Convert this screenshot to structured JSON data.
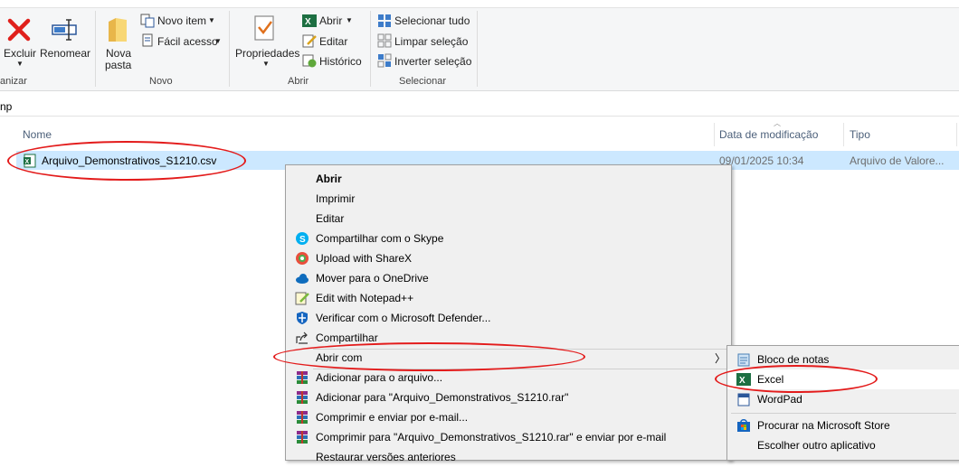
{
  "ribbon": {
    "excluir_label": "Excluir",
    "renomear_label": "Renomear",
    "nova_pasta_label_1": "Nova",
    "nova_pasta_label_2": "pasta",
    "novo_item_label": "Novo item",
    "facil_acesso_label": "Fácil acesso",
    "propriedades_label": "Propriedades",
    "abrir_label": "Abrir",
    "editar_label": "Editar",
    "historico_label": "Histórico",
    "selecionar_tudo_label": "Selecionar tudo",
    "limpar_selecao_label": "Limpar seleção",
    "inverter_selecao_label": "Inverter seleção",
    "groups": {
      "organizar": "anizar",
      "novo": "Novo",
      "abrir": "Abrir",
      "selecionar": "Selecionar"
    }
  },
  "address": {
    "text": "np"
  },
  "columns": {
    "nome": "Nome",
    "data": "Data de modificação",
    "tipo": "Tipo"
  },
  "file": {
    "name": "Arquivo_Demonstrativos_S1210.csv",
    "date": "09/01/2025 10:34",
    "type": "Arquivo de Valore..."
  },
  "context_menu": {
    "items": [
      {
        "label": "Abrir"
      },
      {
        "label": "Imprimir"
      },
      {
        "label": "Editar"
      },
      {
        "label": "Compartilhar com o Skype"
      },
      {
        "label": "Upload with ShareX"
      },
      {
        "label": "Mover para o OneDrive"
      },
      {
        "label": "Edit with Notepad++"
      },
      {
        "label": "Verificar com o Microsoft Defender..."
      },
      {
        "label": "Compartilhar"
      },
      {
        "label": "Abrir com"
      },
      {
        "label": "Adicionar para o arquivo..."
      },
      {
        "label": "Adicionar para \"Arquivo_Demonstrativos_S1210.rar\""
      },
      {
        "label": "Comprimir e enviar por e-mail..."
      },
      {
        "label": "Comprimir para \"Arquivo_Demonstrativos_S1210.rar\" e enviar por e-mail"
      },
      {
        "label": "Restaurar versões anteriores"
      }
    ]
  },
  "submenu": {
    "items": [
      {
        "label": "Bloco de notas"
      },
      {
        "label": "Excel"
      },
      {
        "label": "WordPad"
      },
      {
        "label": "Procurar na Microsoft Store"
      },
      {
        "label": "Escolher outro aplicativo"
      }
    ]
  },
  "colors": {
    "selection": "#cce8ff",
    "highlight_oval": "#e31b1b",
    "menu_bg": "#f0f0f0"
  }
}
